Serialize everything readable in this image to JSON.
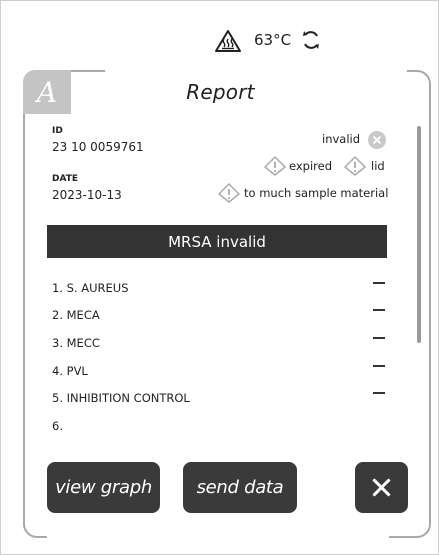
{
  "status": {
    "temperature": "63°C",
    "heat_icon": "heat-warning-icon",
    "sync_icon": "sync-icon"
  },
  "card": {
    "tab_letter": "A",
    "title": "Report",
    "id_label": "ID",
    "id_value": "23 10 0059761",
    "date_label": "DATE",
    "date_value": "2023-10-13",
    "status_invalid": "invalid",
    "status_expired": "expired",
    "status_lid": "lid",
    "status_sample": "to much sample material"
  },
  "banner": "MRSA invalid",
  "targets": [
    {
      "label": "1. S. AUREUS",
      "result": "—"
    },
    {
      "label": "2. MECA",
      "result": "—"
    },
    {
      "label": "3. MECC",
      "result": "—"
    },
    {
      "label": "4. PVL",
      "result": "—"
    },
    {
      "label": "5. INHIBITION CONTROL",
      "result": "—"
    },
    {
      "label": "6.",
      "result": ""
    }
  ],
  "buttons": {
    "view_graph": "view graph",
    "send_data": "send data",
    "close_icon": "close-icon"
  }
}
